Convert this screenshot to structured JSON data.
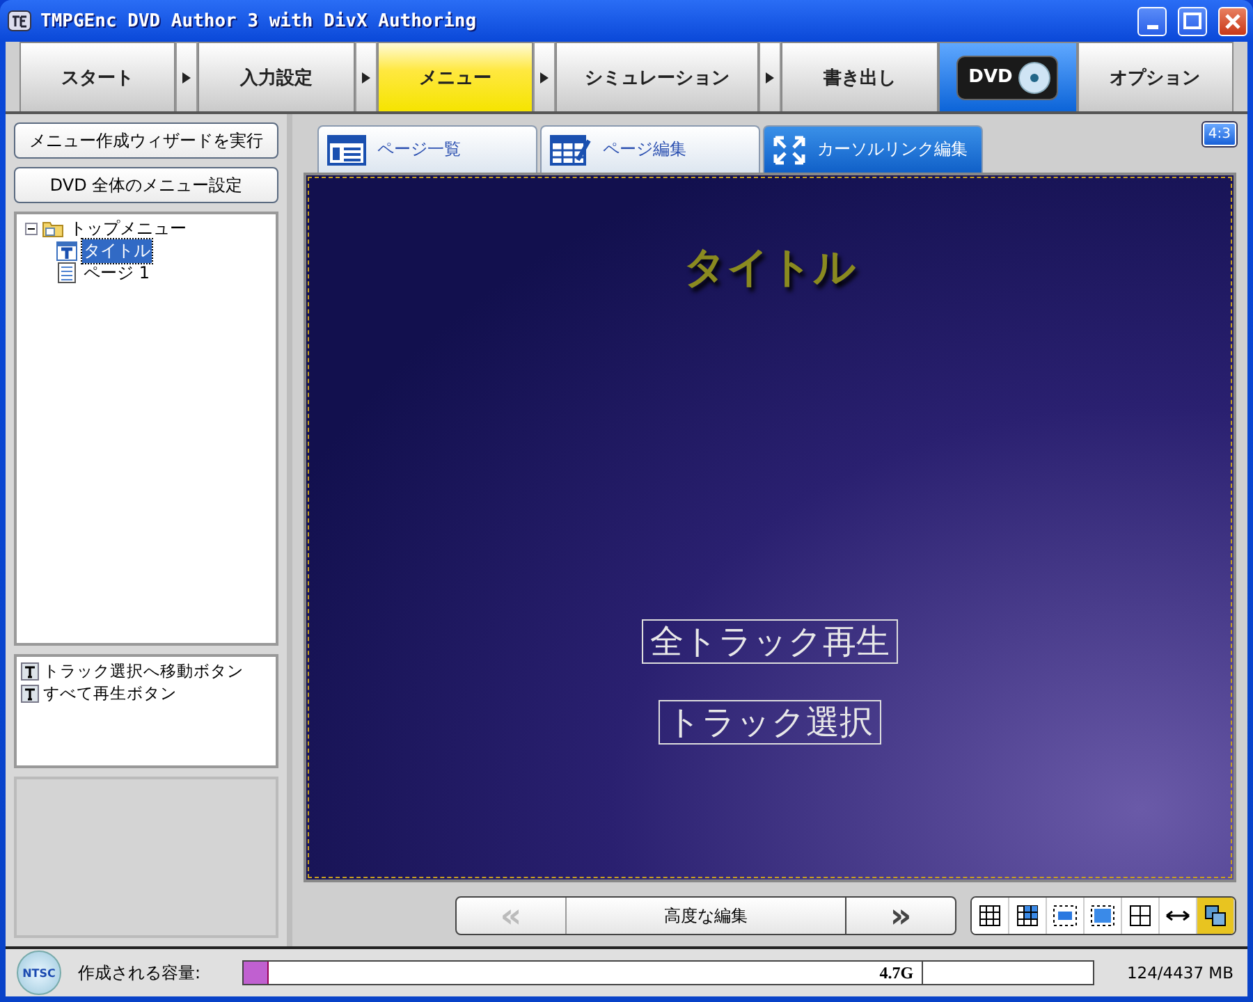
{
  "window": {
    "title": "TMPGEnc DVD Author 3 with DivX Authoring"
  },
  "steps": [
    {
      "label": "スタート",
      "kind": "text",
      "selected": false
    },
    {
      "label": "入力設定",
      "kind": "text",
      "selected": false
    },
    {
      "label": "メニュー",
      "kind": "text",
      "selected": true
    },
    {
      "label": "シミュレーション",
      "kind": "text",
      "selected": false
    },
    {
      "label": "書き出し",
      "kind": "text",
      "selected": false
    },
    {
      "label": "DVD",
      "kind": "logo",
      "selected": false
    },
    {
      "label": "オプション",
      "kind": "text",
      "selected": false
    }
  ],
  "sidebar": {
    "buttons": [
      "メニュー作成ウィザードを実行",
      "DVD 全体のメニュー設定"
    ],
    "tree": [
      {
        "label": "トップメニュー",
        "expanded": true,
        "selected": false,
        "children": [
          {
            "label": "タイトル",
            "selected": true
          },
          {
            "label": "ページ 1",
            "selected": false
          }
        ]
      }
    ],
    "objects": [
      {
        "label": "トラック選択へ移動ボタン"
      },
      {
        "label": "すべて再生ボタン"
      }
    ]
  },
  "view_tabs": [
    {
      "label": "ページ一覧",
      "selected": false
    },
    {
      "label": "ページ編集",
      "selected": false
    },
    {
      "label": "カーソルリンク編集",
      "selected": true
    }
  ],
  "aspect_button": "4:3",
  "preview": {
    "title": "タイトル",
    "buttons": [
      "全トラック再生",
      "トラック選択"
    ]
  },
  "nav": {
    "prev": "«",
    "prev_disabled": true,
    "center": "高度な編集",
    "next": "»"
  },
  "view_toggles": [
    {
      "selected": false
    },
    {
      "selected": false
    },
    {
      "selected": false
    },
    {
      "selected": false
    },
    {
      "selected": false
    },
    {
      "selected": false
    },
    {
      "selected": true
    }
  ],
  "status_bar": {
    "format": "NTSC",
    "label": "作成される容量:",
    "capacity": {
      "level": 0.028,
      "mark": "4.7G"
    },
    "usage": "124/4437 MB"
  }
}
